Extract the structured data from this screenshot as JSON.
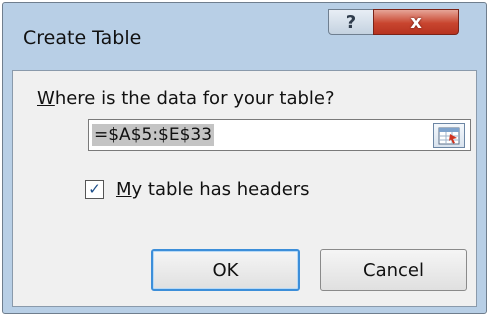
{
  "window": {
    "title": "Create Table",
    "help_label": "?",
    "close_label": "x"
  },
  "dialog": {
    "prompt_underlined": "W",
    "prompt_rest": "here is the data for your table?",
    "range_value": "=$A$5:$E$33",
    "checkbox_checked": true,
    "checkbox_mark": "✓",
    "checkbox_label_underlined": "M",
    "checkbox_label_rest": "y table has headers",
    "ok_label": "OK",
    "cancel_label": "Cancel"
  },
  "icons": {
    "collapse": "range-selector-icon",
    "help": "help-icon",
    "close": "close-icon"
  },
  "colors": {
    "title_bar": "#b8cfe6",
    "close_button": "#c8452f",
    "default_button_border": "#3c8ed9"
  }
}
